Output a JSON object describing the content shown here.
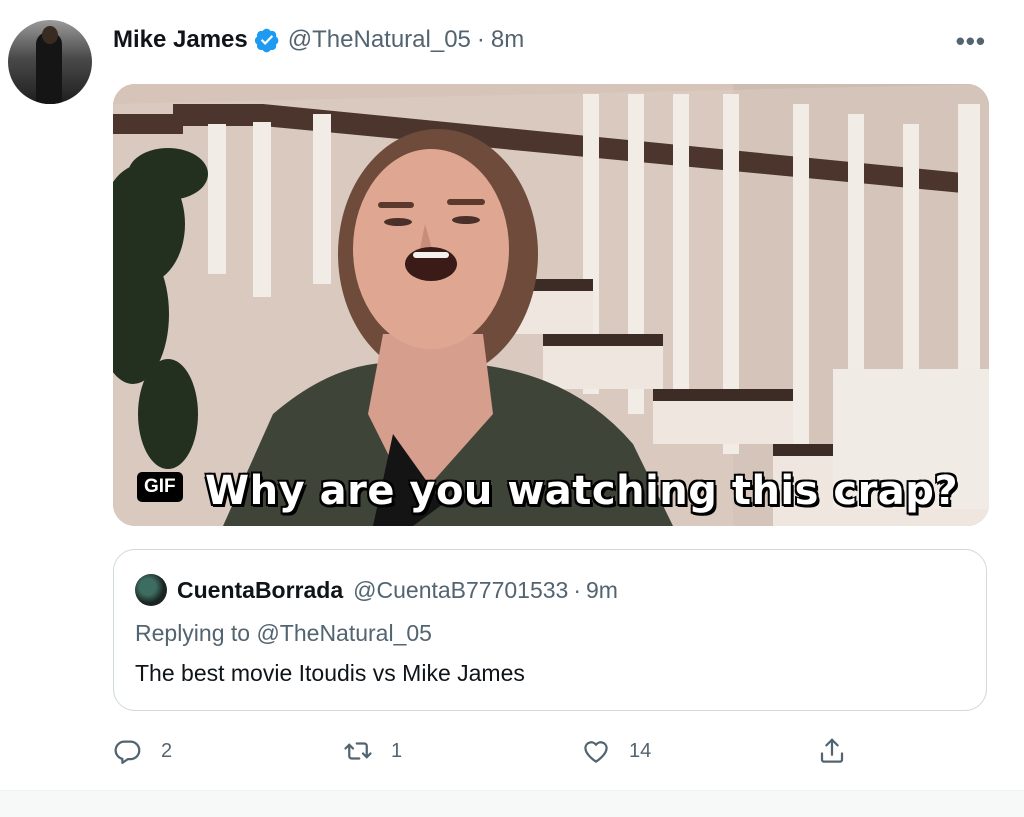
{
  "tweet": {
    "author_name": "Mike James",
    "author_handle": "@TheNatural_05",
    "separator": "·",
    "time": "8m",
    "more_label": "•••",
    "media": {
      "badge": "GIF",
      "caption": "Why are you watching this crap?"
    },
    "quote": {
      "author_name": "CuentaBorrada",
      "author_handle": "@CuentaB77701533",
      "separator": "·",
      "time": "9m",
      "reply_line": "Replying to @TheNatural_05",
      "text": "The best movie Itoudis vs Mike James"
    },
    "actions": {
      "reply_count": "2",
      "retweet_count": "1",
      "like_count": "14"
    }
  },
  "icons": {
    "verified": "verified-badge-icon",
    "reply": "reply-icon",
    "retweet": "retweet-icon",
    "like": "heart-icon",
    "share": "share-icon"
  },
  "colors": {
    "verified": "#1d9bf0",
    "secondary_text": "#536471",
    "primary_text": "#0f1419",
    "border": "#cfd9de"
  }
}
